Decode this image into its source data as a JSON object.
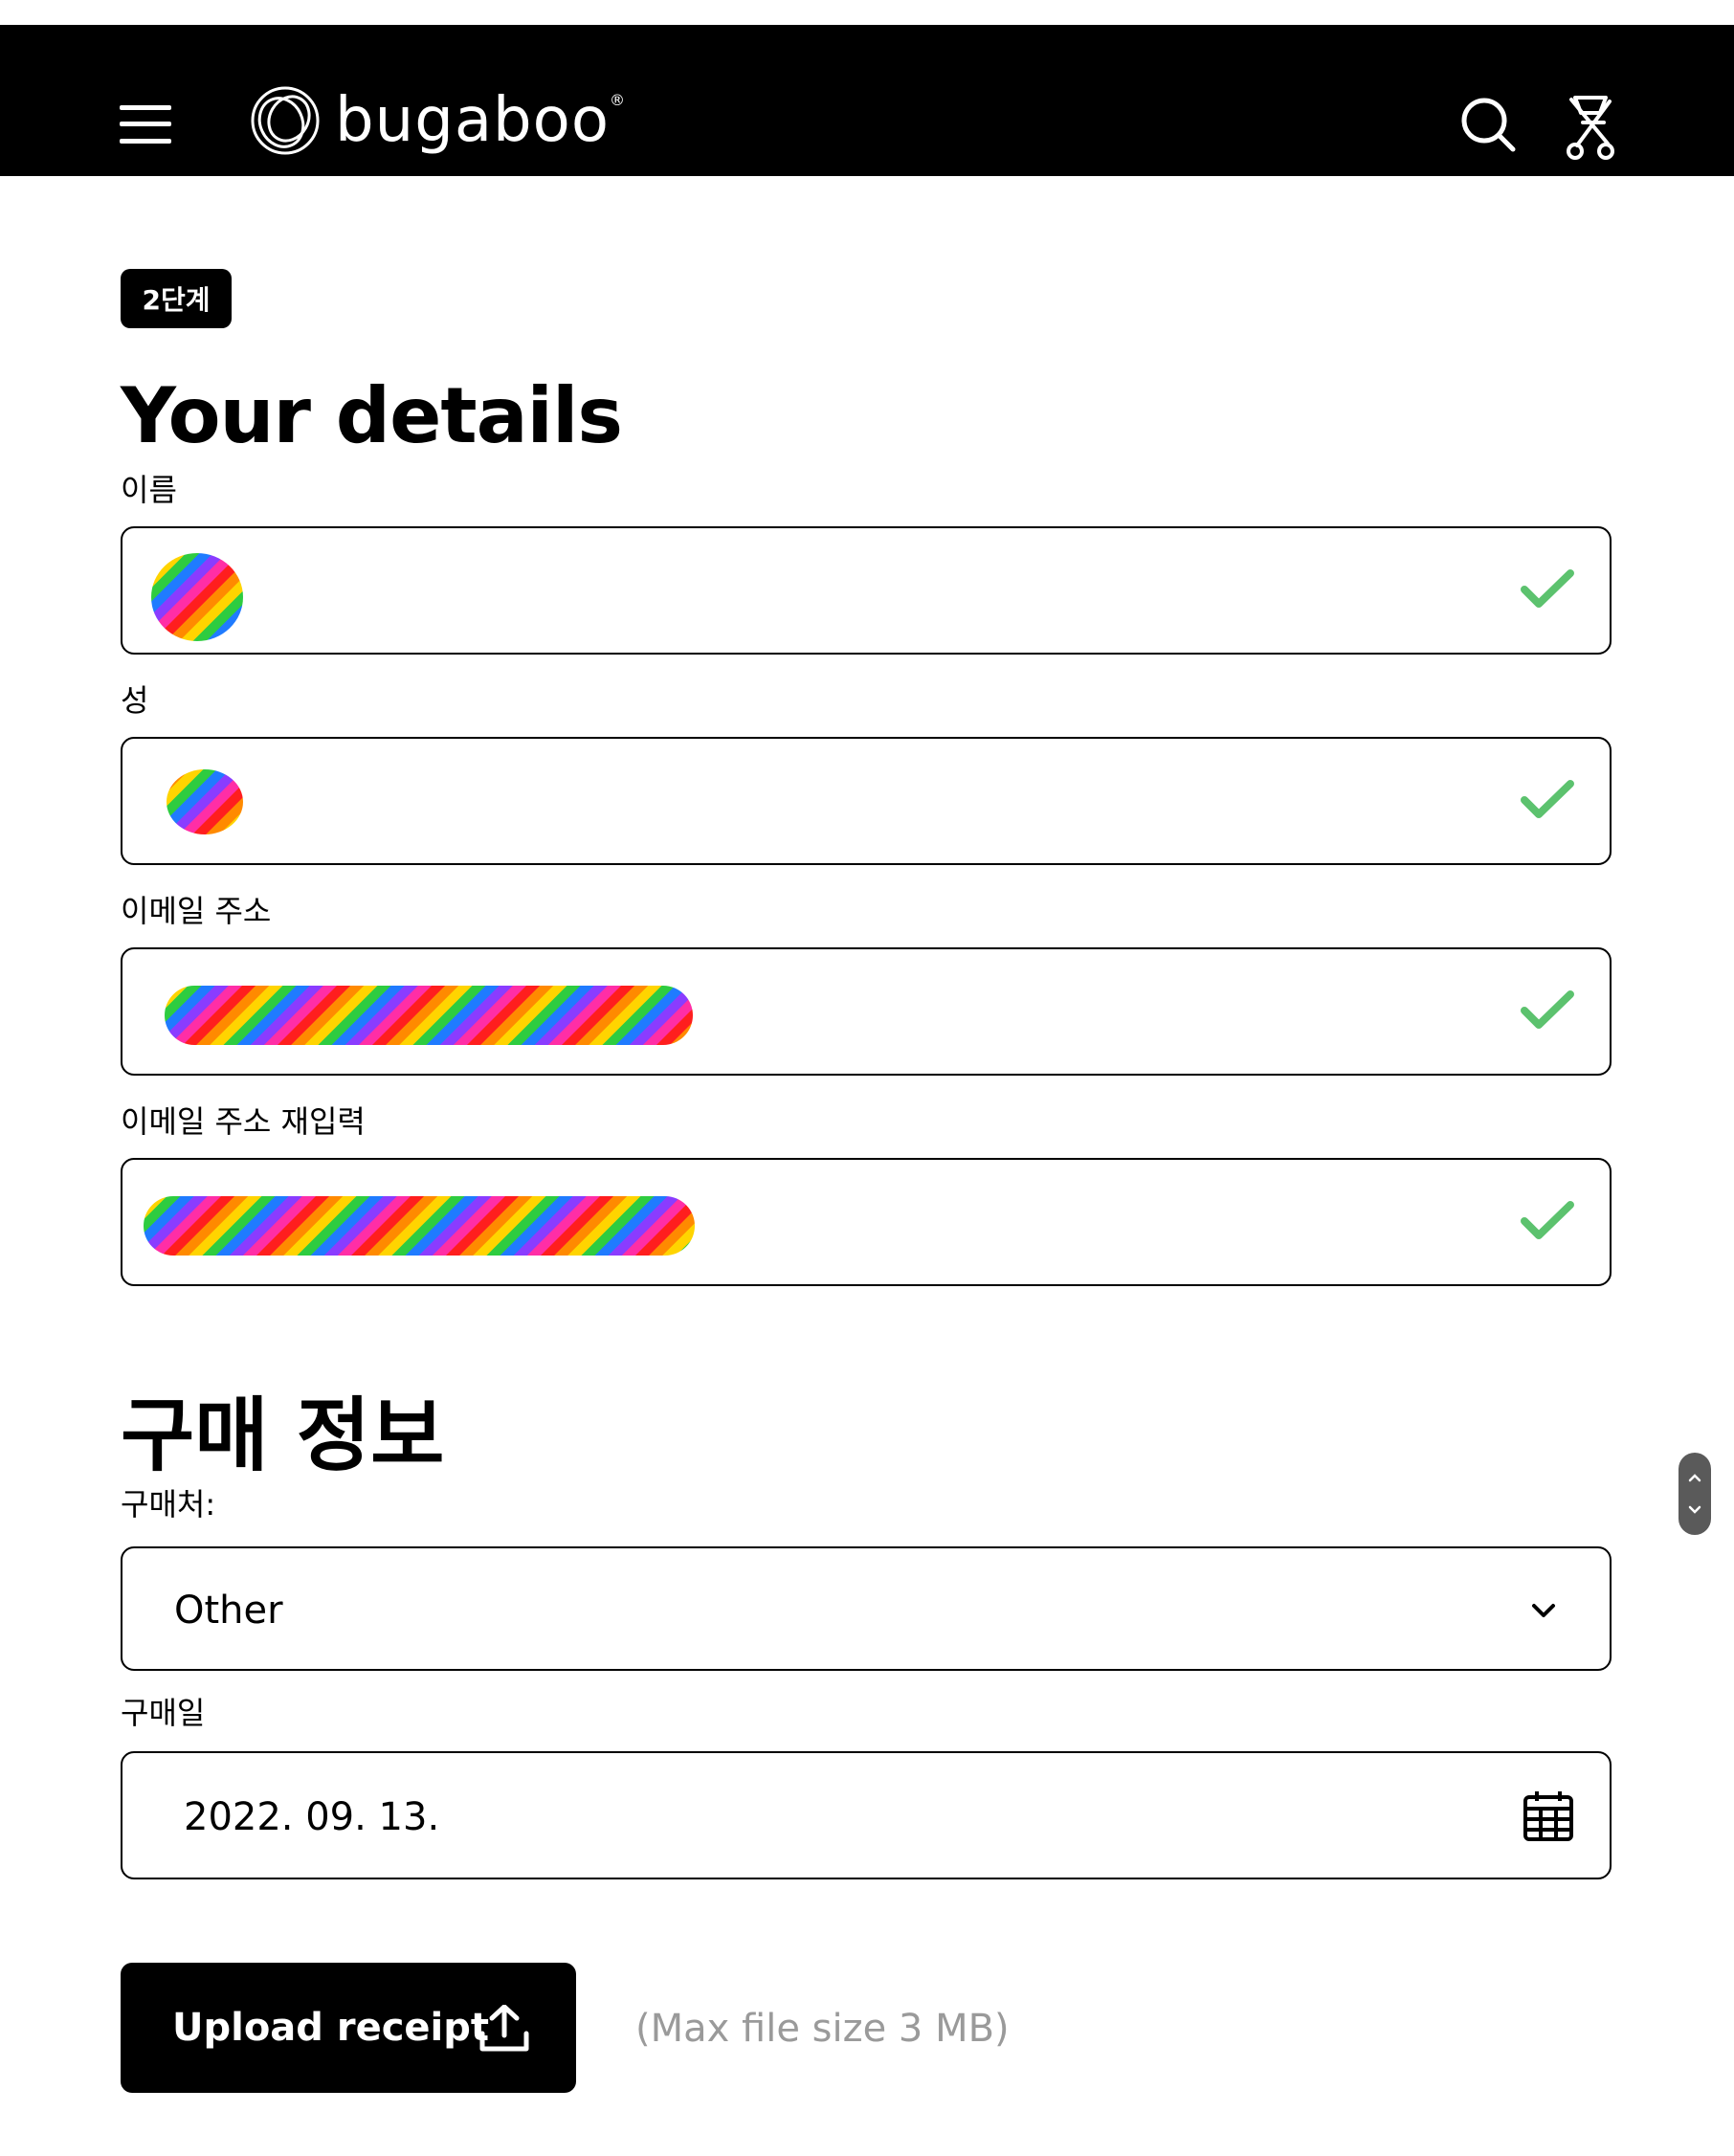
{
  "header": {
    "logo_text": "bugaboo",
    "logo_reg": "®",
    "menu_icon": "hamburger-menu-icon",
    "search_icon": "search-icon",
    "stroller_icon": "stroller-icon",
    "background": "#000000"
  },
  "step_badge": "2단계",
  "details": {
    "title": "Your details",
    "fields": [
      {
        "label": "이름",
        "value": "",
        "status": "valid"
      },
      {
        "label": "성",
        "value": "",
        "status": "valid"
      },
      {
        "label": "이메일 주소",
        "value": "",
        "status": "valid"
      },
      {
        "label": "이메일 주소 재입력",
        "value": "",
        "status": "valid"
      }
    ]
  },
  "purchase": {
    "title": "구매 정보",
    "store_label": "구매처:",
    "store_value": "Other",
    "date_label": "구매일",
    "date_value": "2022. 09. 13.",
    "upload_label": "Upload receipt",
    "max_note": "(Max file size 3 MB)"
  },
  "colors": {
    "check": "#5cc26e",
    "max_note": "#9a9a9a",
    "redaction_stripes": [
      "#ff1e1e",
      "#ff8a00",
      "#ffd400",
      "#2ecc40",
      "#1f7bff",
      "#8a3cff",
      "#ff2ea6"
    ]
  }
}
